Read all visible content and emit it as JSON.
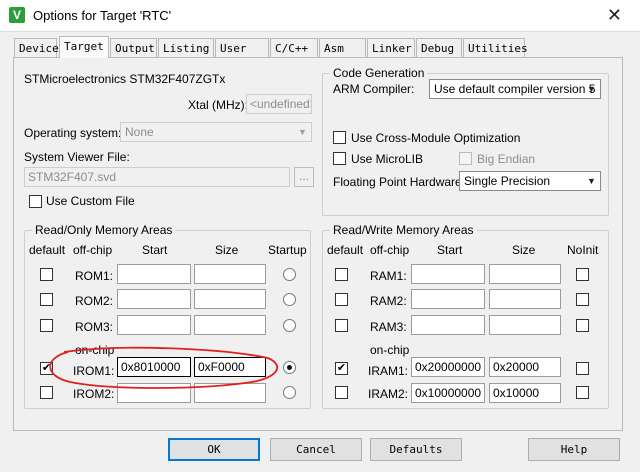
{
  "window": {
    "title": "Options for Target 'RTC'",
    "close_glyph": "✕",
    "app_icon_glyph": "V"
  },
  "tabs": [
    "Device",
    "Target",
    "Output",
    "Listing",
    "User",
    "C/C++",
    "Asm",
    "Linker",
    "Debug",
    "Utilities"
  ],
  "device": {
    "name": "STMicroelectronics STM32F407ZGTx",
    "xtal_label": "Xtal (MHz):",
    "xtal_value": "<undefined>",
    "os_label": "Operating system:",
    "os_value": "None",
    "sv_label": "System Viewer File:",
    "sv_value": "STM32F407.svd",
    "browse": "...",
    "custom_file_label": "Use Custom File"
  },
  "codegen": {
    "title": "Code Generation",
    "compiler_label": "ARM Compiler:",
    "compiler_value": "Use default compiler version 5",
    "cross_module_label": "Use Cross-Module Optimization",
    "microlib_label": "Use MicroLIB",
    "big_endian_label": "Big Endian",
    "fpu_label": "Floating Point Hardware:",
    "fpu_value": "Single Precision"
  },
  "rom": {
    "title": "Read/Only Memory Areas",
    "headers": {
      "default": "default",
      "offchip": "off-chip",
      "start": "Start",
      "size": "Size",
      "startup": "Startup"
    },
    "onchip": "on-chip",
    "rows": [
      {
        "name": "ROM1:",
        "start": "",
        "size": "",
        "default": false,
        "startup": false
      },
      {
        "name": "ROM2:",
        "start": "",
        "size": "",
        "default": false,
        "startup": false
      },
      {
        "name": "ROM3:",
        "start": "",
        "size": "",
        "default": false,
        "startup": false
      },
      {
        "name": "IROM1:",
        "start": "0x8010000",
        "size": "0xF0000",
        "default": true,
        "startup": true
      },
      {
        "name": "IROM2:",
        "start": "",
        "size": "",
        "default": false,
        "startup": false
      }
    ]
  },
  "ram": {
    "title": "Read/Write Memory Areas",
    "headers": {
      "default": "default",
      "offchip": "off-chip",
      "start": "Start",
      "size": "Size",
      "noinit": "NoInit"
    },
    "onchip": "on-chip",
    "rows": [
      {
        "name": "RAM1:",
        "start": "",
        "size": "",
        "default": false
      },
      {
        "name": "RAM2:",
        "start": "",
        "size": "",
        "default": false
      },
      {
        "name": "RAM3:",
        "start": "",
        "size": "",
        "default": false
      },
      {
        "name": "IRAM1:",
        "start": "0x20000000",
        "size": "0x20000",
        "default": true
      },
      {
        "name": "IRAM2:",
        "start": "0x10000000",
        "size": "0x10000",
        "default": false
      }
    ]
  },
  "buttons": {
    "ok": "OK",
    "cancel": "Cancel",
    "defaults": "Defaults",
    "help": "Help"
  },
  "check_glyph": "✔",
  "arrow_glyph": "▼",
  "colors": {
    "annotation": "#e0201e",
    "accent": "#0078d7"
  }
}
